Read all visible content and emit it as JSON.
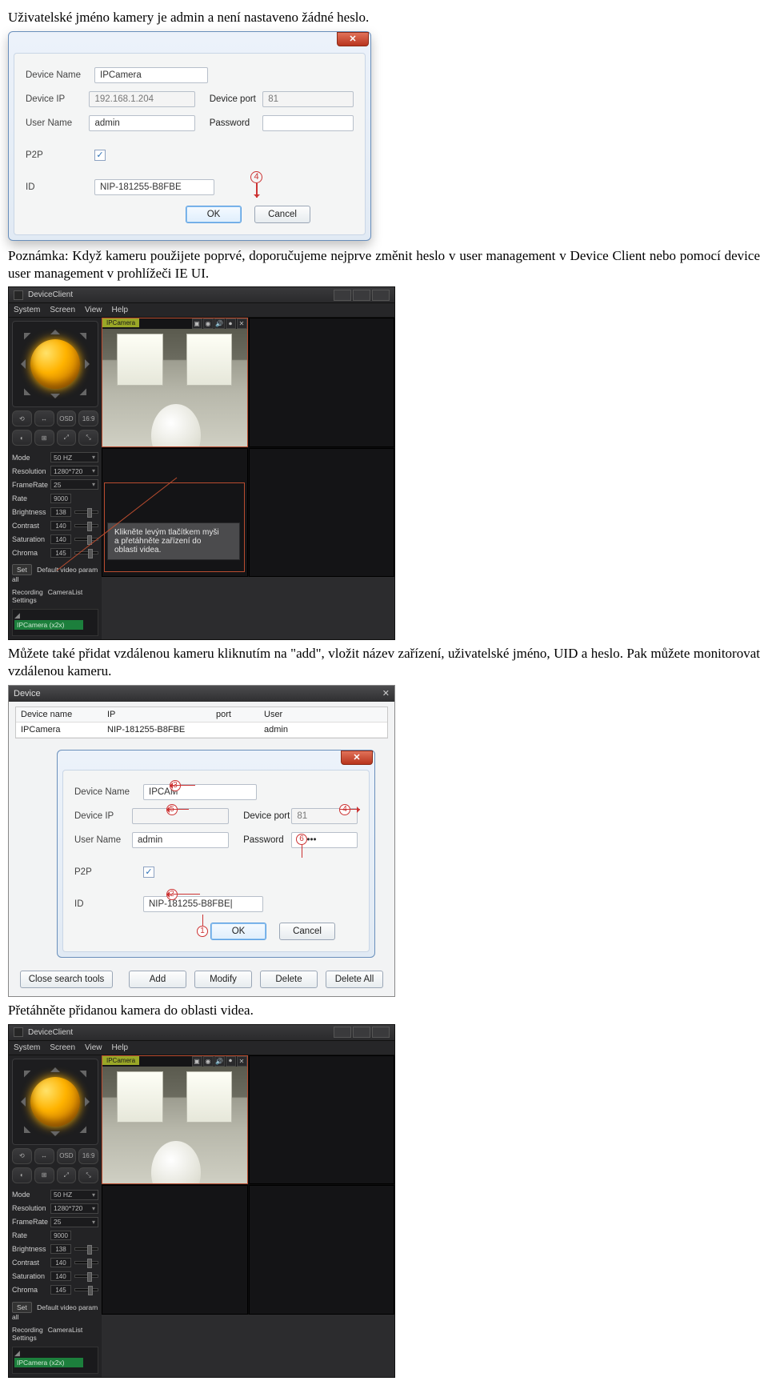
{
  "text": {
    "p1": "Uživatelské jméno kamery je admin a není nastaveno žádné heslo.",
    "p2": "Poznámka: Když kameru použijete poprvé, doporučujeme nejprve změnit heslo v user management v Device Client nebo pomocí device user management v prohlížeči IE UI.",
    "p3": "Můžete také přidat vzdálenou kameru kliknutím na \"add\", vložit název zařízení, uživatelské jméno, UID a heslo. Pak můžete monitorovat vzdálenou kameru.",
    "p4": "Přetáhněte přidanou kamera do oblasti videa."
  },
  "dialog1": {
    "fields": {
      "device_name_label": "Device Name",
      "device_name": "IPCamera",
      "device_ip_label": "Device IP",
      "device_ip": "192.168.1.204",
      "device_port_label": "Device port",
      "device_port": "81",
      "user_name_label": "User Name",
      "user_name": "admin",
      "password_label": "Password",
      "password": "",
      "p2p_label": "P2P",
      "p2p_checked": "✓",
      "id_label": "ID",
      "id": "NIP-181255-B8FBE"
    },
    "ok": "OK",
    "cancel": "Cancel",
    "annot": "4"
  },
  "deviceClient": {
    "title": "DeviceClient",
    "menu": [
      "System",
      "Screen",
      "View",
      "Help"
    ],
    "controls_row1": [
      "⟲",
      "↔",
      "OSD",
      "16:9"
    ],
    "controls_row2": [
      "◐",
      "⊞",
      "⤢",
      "⤡"
    ],
    "settings": {
      "mode_label": "Mode",
      "mode": "50 HZ",
      "res_label": "Resolution",
      "res": "1280*720",
      "fr_label": "FrameRate",
      "fr": "25",
      "rate_label": "Rate",
      "rate": "9000",
      "bright_label": "Brightness",
      "bright": "138",
      "contrast_label": "Contrast",
      "contrast": "140",
      "sat_label": "Saturation",
      "sat": "140",
      "chroma_label": "Chroma",
      "chroma": "145",
      "set": "Set",
      "defv": "Default video param all",
      "rec": "Recording\nSettings",
      "camlist": "CameraList",
      "tree_root": "◢",
      "tree_cam": "IPCamera (x2x)"
    },
    "camTab": "IPCamera",
    "tooltip": "Klikněte levým tlačítkem myši\na přetáhněte zařízení do\noblasti videa."
  },
  "devmgr": {
    "title": "Device",
    "headers": {
      "name": "Device name",
      "ip": "IP",
      "port": "port",
      "user": "User"
    },
    "row": {
      "name": "IPCamera",
      "ip": "NIP-181255-B8FBE",
      "port": "",
      "user": "admin"
    },
    "popup": {
      "device_name_label": "Device Name",
      "device_name": "IPCAM",
      "device_ip_label": "Device IP",
      "device_ip": "",
      "device_port_label": "Device port",
      "device_port": "81",
      "user_name_label": "User Name",
      "user_name": "admin",
      "password_label": "Password",
      "password": "••••••",
      "p2p_label": "P2P",
      "p2p_checked": "✓",
      "id_label": "ID",
      "id": "NIP-181255-B8FBE|",
      "ok": "OK",
      "cancel": "Cancel",
      "annots": {
        "a1": "1",
        "a2": "2",
        "a3": "3",
        "a4": "4",
        "a5": "5",
        "a6": "6"
      }
    },
    "buttons": {
      "close": "Close search tools",
      "add": "Add",
      "modify": "Modify",
      "delete": "Delete",
      "deleteAll": "Delete All"
    }
  }
}
